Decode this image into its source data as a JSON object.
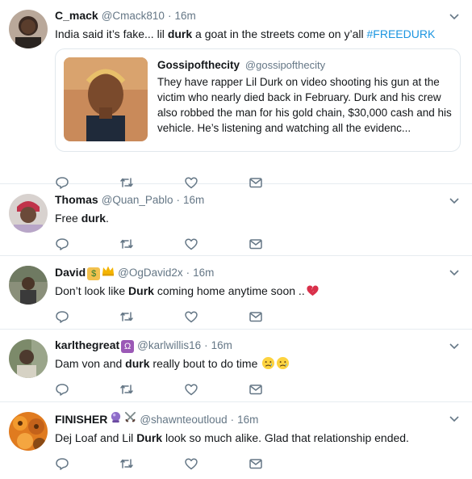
{
  "colors": {
    "accent": "#1b95e0",
    "muted": "#657786",
    "text": "#14171a",
    "border": "#e6ecf0"
  },
  "tweets": [
    {
      "name": "C_mack",
      "handle": "@Cmack810",
      "dot": "·",
      "time": "16m",
      "text_pre": "India said it’s fake... lil ",
      "text_bold": "durk",
      "text_post": " a goat in the streets come on y’all ",
      "hashtag": "#FREEDURK",
      "quote": {
        "name": "Gossipofthecity",
        "handle": "@gossipofthecity",
        "text": "They have rapper Lil Durk on video shooting his gun at the victim who nearly died back in February. Durk and his crew also robbed the man for his gold chain, $30,000 cash and his vehicle. He’s listening and watching all the evidenc..."
      }
    },
    {
      "name": "Thomas",
      "handle": "@Quan_Pablo",
      "dot": "·",
      "time": "16m",
      "text_pre": "Free ",
      "text_bold": "durk",
      "text_post": "."
    },
    {
      "name": "David",
      "handle": "@OgDavid2x",
      "dot": "·",
      "time": "16m",
      "name_emojis": [
        "money-bag-emoji",
        "crown-emoji"
      ],
      "text_pre": "Don’t look like ",
      "text_bold": "Durk",
      "text_post": " coming home anytime soon ..",
      "text_emojis": [
        "broken-heart-emoji"
      ]
    },
    {
      "name": "karlthegreat",
      "handle": "@karlwillis16",
      "dot": "·",
      "time": "16m",
      "name_emojis": [
        "libra-emoji"
      ],
      "text_pre": "Dam von and ",
      "text_bold": "durk",
      "text_post": " really bout to do time ",
      "text_emojis": [
        "sad-face-emoji",
        "sad-face-emoji"
      ]
    },
    {
      "name": "FINISHER",
      "handle": "@shawnteoutloud",
      "dot": "·",
      "time": "16m",
      "name_emojis": [
        "crystal-ball-emoji",
        "crossed-swords-emoji"
      ],
      "text_pre": "Dej Loaf and Lil ",
      "text_bold": "Durk",
      "text_post": " look so much alike. Glad that relationship ended."
    }
  ]
}
